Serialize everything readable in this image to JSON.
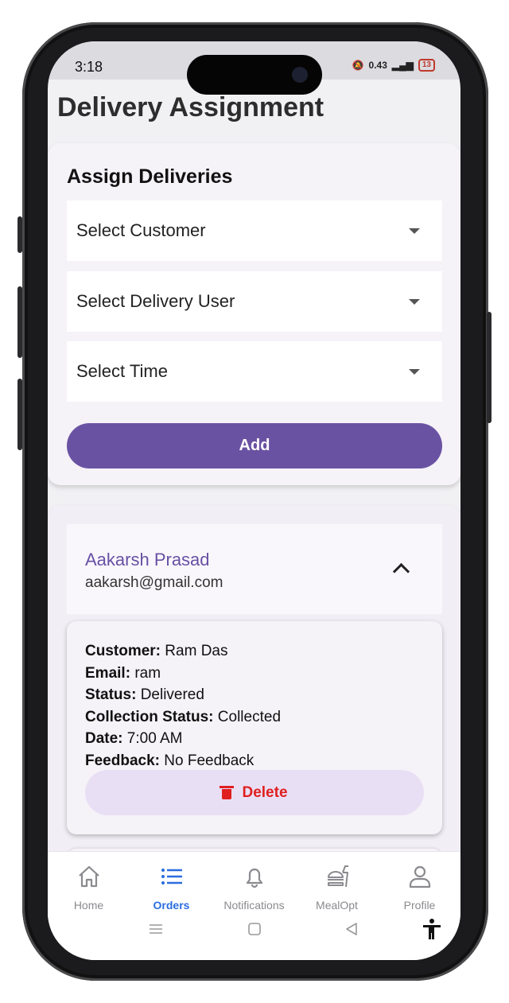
{
  "status_bar": {
    "time": "3:18",
    "net_speed": "0.43",
    "net_unit": "KB/S",
    "battery": "13"
  },
  "page": {
    "title": "Delivery Assignment"
  },
  "assign_card": {
    "title": "Assign Deliveries",
    "customer_select": "Select Customer",
    "delivery_user_select": "Select Delivery User",
    "time_select": "Select Time",
    "add_label": "Add"
  },
  "assignment": {
    "name": "Aakarsh Prasad",
    "email": "aakarsh@gmail.com",
    "order": {
      "customer_label": "Customer:",
      "customer": "Ram Das",
      "email_label": "Email:",
      "email": "ram",
      "status_label": "Status:",
      "status": "Delivered",
      "collection_label": "Collection Status:",
      "collection": "Collected",
      "date_label": "Date:",
      "date": "7:00 AM",
      "feedback_label": "Feedback:",
      "feedback": "No Feedback",
      "delete_label": "Delete"
    }
  },
  "nav": {
    "items": [
      {
        "label": "Home",
        "icon": "home-icon"
      },
      {
        "label": "Orders",
        "icon": "list-icon",
        "active": true
      },
      {
        "label": "Notifications",
        "icon": "bell-icon"
      },
      {
        "label": "MealOpt",
        "icon": "food-icon"
      },
      {
        "label": "Profile",
        "icon": "person-icon"
      }
    ]
  },
  "colors": {
    "primary": "#6a52a3",
    "accent_blue": "#2b6de0",
    "delete_red": "#e01f1f"
  }
}
